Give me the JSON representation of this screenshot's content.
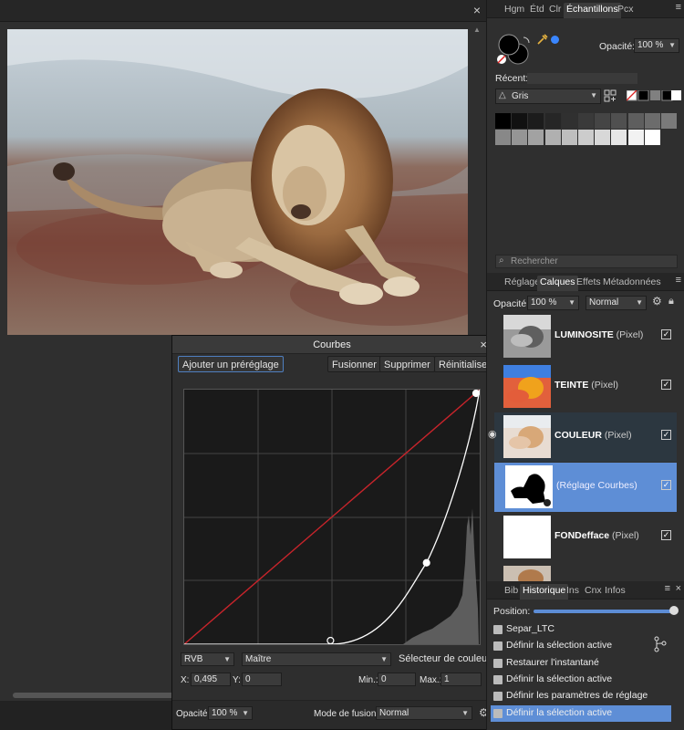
{
  "canvas": {
    "close_glyph": "×",
    "scroll_up_glyph": "▲"
  },
  "curves": {
    "title": "Courbes",
    "close_glyph": "×",
    "buttons": {
      "preset": "Ajouter un préréglage",
      "merge": "Fusionner",
      "delete": "Supprimer",
      "reset": "Réinitialiser"
    },
    "channel_mode": "RVB",
    "channel": "Maître",
    "color_picker_label": "Sélecteur de couleur",
    "x_label": "X:",
    "x_value": "0,495",
    "y_label": "Y:",
    "y_value": "0",
    "min_label": "Min.:",
    "min_value": "0",
    "max_label": "Max.:",
    "max_value": "1",
    "opacity_label": "Opacité:",
    "opacity_value": "100 %",
    "blend_label": "Mode de fusion:",
    "blend_value": "Normal",
    "curve_points": [
      [
        0,
        0
      ],
      [
        0.495,
        0
      ],
      [
        0.82,
        0.32
      ],
      [
        1,
        1
      ]
    ],
    "curve_color": "#ffffff",
    "diagonal_color": "#c8242b"
  },
  "swatches_tabs": {
    "tabs": [
      "Hgm",
      "Étd",
      "Clr",
      "Échantillons",
      "Pcx"
    ],
    "active": "Échantillons",
    "menu_glyph": "≡"
  },
  "swatches": {
    "opacity_label": "Opacité:",
    "opacity_value": "100 %",
    "recent_label": "Récent:",
    "palette_name": "Gris",
    "search_placeholder": "Rechercher",
    "accent_color": "#3a86ff",
    "grid_row1": [
      "#000000",
      "#111111",
      "#1c1c1c",
      "#262626",
      "#303030",
      "#3a3a3a",
      "#454545",
      "#505050",
      "#5e5e5e",
      "#6c6c6c",
      "#7a7a7a"
    ],
    "grid_row2": [
      "#888888",
      "#959595",
      "#a2a2a2",
      "#b0b0b0",
      "#bebebe",
      "#cccccc",
      "#d8d8d8",
      "#e6e6e6",
      "#f2f2f2",
      "#ffffff"
    ]
  },
  "layers_tabs": {
    "tabs": [
      "Réglage",
      "Calques",
      "Effets",
      "Métadonnées"
    ],
    "active": "Calques",
    "menu_glyph": "≡"
  },
  "layers": {
    "opacity_label": "Opacité:",
    "opacity_value": "100 %",
    "blend_value": "Normal",
    "items": [
      {
        "name": "LUMINOSITE",
        "type": "(Pixel)"
      },
      {
        "name": "TEINTE",
        "type": "(Pixel)"
      },
      {
        "name": "COULEUR",
        "type": "(Pixel)"
      },
      {
        "name": "",
        "type": "(Réglage Courbes)"
      },
      {
        "name": "FONDefface",
        "type": "(Pixel)"
      }
    ]
  },
  "history_tabs": {
    "tabs": [
      "Bib",
      "Historique",
      "Ins",
      "Cnx",
      "Infos"
    ],
    "active": "Historique",
    "menu_glyph": "≡",
    "close_glyph": "×"
  },
  "history": {
    "position_label": "Position:",
    "position_fraction": 1.0,
    "items": [
      "Separ_LTC",
      "Définir la sélection active",
      "Restaurer l'instantané",
      "Définir la sélection active",
      "Définir les paramètres de réglage",
      "Définir la sélection active"
    ],
    "active_index": 5
  }
}
